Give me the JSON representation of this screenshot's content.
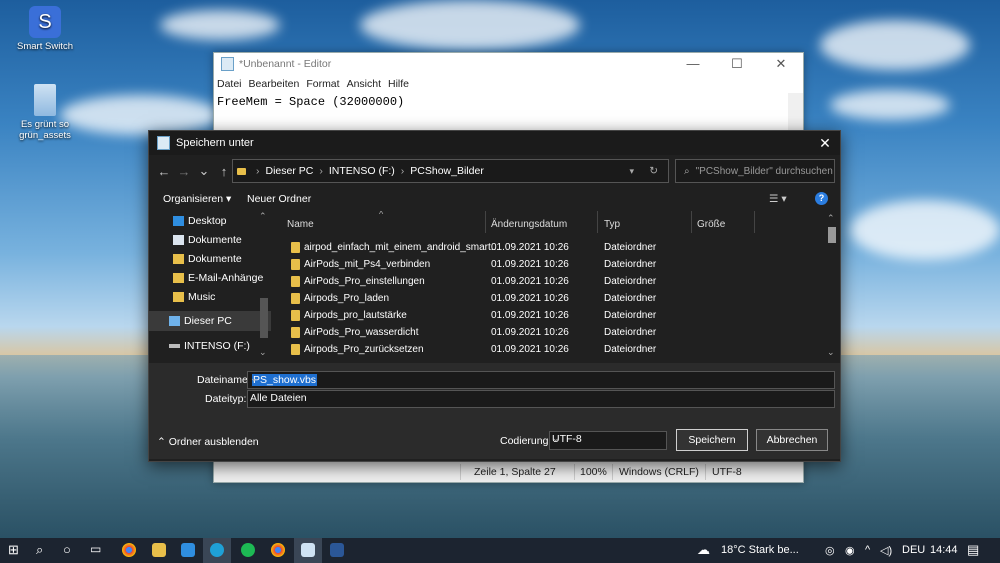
{
  "colors": {
    "accent": "#2b7de0",
    "selection": "#1e6fd0",
    "folder": "#e8bf4a",
    "dialog_bg": "#202020"
  },
  "desktop": {
    "icons": [
      {
        "label": "Smart Switch",
        "icon": "smart-switch-icon"
      },
      {
        "label": "Es grünt so grün_assets",
        "icon": "zip-folder-icon"
      }
    ]
  },
  "notepad": {
    "title": "*Unbenannt - Editor",
    "controls": [
      "—",
      "☐",
      "✕"
    ],
    "menu": [
      "Datei",
      "Bearbeiten",
      "Format",
      "Ansicht",
      "Hilfe"
    ],
    "content": "FreeMem = Space (32000000)",
    "status": {
      "position": "Zeile 1, Spalte 27",
      "zoom": "100%",
      "line_ending": "Windows (CRLF)",
      "encoding": "UTF-8"
    }
  },
  "dialog": {
    "title": "Speichern unter",
    "close": "✕",
    "nav": {
      "back": "←",
      "forward": "→",
      "history": "⌄",
      "up": "↑",
      "refresh": "↻"
    },
    "breadcrumb": [
      "Dieser PC",
      "INTENSO (F:)",
      "PCShow_Bilder"
    ],
    "search_placeholder": "\"PCShow_Bilder\" durchsuchen",
    "toolbar": {
      "organize": "Organisieren ▾",
      "new_folder": "Neuer Ordner",
      "help": "?"
    },
    "sidebar": [
      {
        "label": "Desktop",
        "icon": "desktop-icon"
      },
      {
        "label": "Dokumente",
        "icon": "documents-icon"
      },
      {
        "label": "Dokumente",
        "icon": "folder-icon"
      },
      {
        "label": "E-Mail-Anhänge",
        "icon": "folder-icon"
      },
      {
        "label": "Music",
        "icon": "folder-icon"
      },
      {
        "label": "Dieser PC",
        "icon": "computer-icon"
      },
      {
        "label": "INTENSO (F:)",
        "icon": "drive-icon"
      }
    ],
    "columns": [
      "Name",
      "Änderungsdatum",
      "Typ",
      "Größe"
    ],
    "files": [
      {
        "name": "airpod_einfach_mit_einem_android_smart...",
        "date": "01.09.2021 10:26",
        "type": "Dateiordner"
      },
      {
        "name": "AirPods_mit_Ps4_verbinden",
        "date": "01.09.2021 10:26",
        "type": "Dateiordner"
      },
      {
        "name": "AirPods_Pro_einstellungen",
        "date": "01.09.2021 10:26",
        "type": "Dateiordner"
      },
      {
        "name": "Airpods_Pro_laden",
        "date": "01.09.2021 10:26",
        "type": "Dateiordner"
      },
      {
        "name": "Airpods_pro_lautstärke",
        "date": "01.09.2021 10:26",
        "type": "Dateiordner"
      },
      {
        "name": "AirPods_Pro_wasserdicht",
        "date": "01.09.2021 10:26",
        "type": "Dateiordner"
      },
      {
        "name": "Airpods_Pro_zurücksetzen",
        "date": "01.09.2021 10:26",
        "type": "Dateiordner"
      }
    ],
    "filename_label": "Dateiname:",
    "filename": "PS_show.vbs",
    "filetype_label": "Dateityp:",
    "filetype": "Alle Dateien",
    "hide_folders": "Ordner ausblenden",
    "encoding_label": "Codierung:",
    "encoding": "UTF-8",
    "save": "Speichern",
    "cancel": "Abbrechen"
  },
  "taskbar": {
    "weather": "18°C  Stark be...",
    "language": "DEU",
    "time": "14:44"
  }
}
